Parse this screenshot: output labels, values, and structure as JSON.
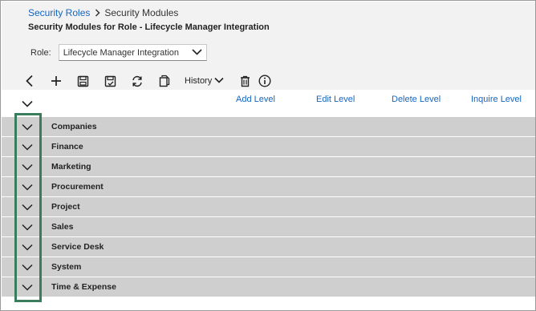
{
  "breadcrumb": {
    "parent": "Security Roles",
    "current": "Security Modules"
  },
  "page_title": "Security Modules for Role - Lifecycle Manager Integration",
  "role": {
    "label": "Role:",
    "value": "Lifecycle Manager Integration"
  },
  "toolbar": {
    "history_label": "History",
    "icons": [
      "back-icon",
      "add-icon",
      "save-icon",
      "save-and-close-icon",
      "refresh-icon",
      "copy-icon",
      "chevron-down-icon",
      "delete-icon",
      "info-icon"
    ]
  },
  "columns": {
    "add_level": "Add Level",
    "edit_level": "Edit Level",
    "delete_level": "Delete Level",
    "inquire_level": "Inquire Level"
  },
  "modules": [
    {
      "label": "Companies"
    },
    {
      "label": "Finance"
    },
    {
      "label": "Marketing"
    },
    {
      "label": "Procurement"
    },
    {
      "label": "Project"
    },
    {
      "label": "Sales"
    },
    {
      "label": "Service Desk"
    },
    {
      "label": "System"
    },
    {
      "label": "Time & Expense"
    }
  ],
  "colors": {
    "link": "#1565c0",
    "row_bg": "#cfcfcf",
    "header_bg": "#f2f2f2",
    "highlight": "#3a7d5d"
  }
}
